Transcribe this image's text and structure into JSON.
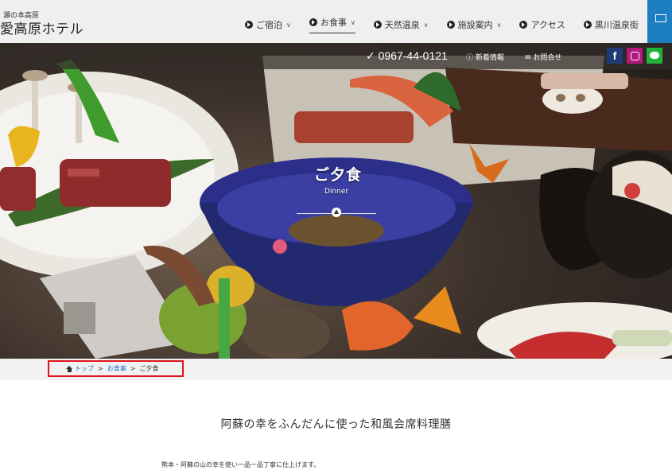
{
  "header": {
    "logo_small": "瀬の本高原",
    "logo_main": "愛高原ホテル",
    "nav": [
      {
        "label": "ご宿泊",
        "dropdown": true,
        "active": false
      },
      {
        "label": "お食事",
        "dropdown": true,
        "active": true
      },
      {
        "label": "天然温泉",
        "dropdown": true,
        "active": false
      },
      {
        "label": "施設案内",
        "dropdown": true,
        "active": false
      },
      {
        "label": "アクセス",
        "dropdown": false,
        "active": false
      },
      {
        "label": "黒川温泉街",
        "dropdown": false,
        "active": false
      }
    ],
    "accent_color": "#1d7fc1"
  },
  "contact": {
    "phone": "0967-44-0121",
    "news_label": "新着情報",
    "inquiry_label": "お問合せ",
    "facebook_glyph": "f",
    "social_icons": [
      "facebook-icon",
      "instagram-icon",
      "line-icon"
    ]
  },
  "hero": {
    "title": "ご夕食",
    "subtitle": "Dinner"
  },
  "breadcrumb": {
    "items": [
      "トップ",
      "お食事",
      "ご夕食"
    ],
    "separator": ">",
    "highlight_color": "#e0151b"
  },
  "main": {
    "heading": "阿蘇の幸をふんだんに使った和風会席料理膳",
    "intro": "熊本・阿蘇の山の幸を使い一品一品丁寧に仕上げます。"
  }
}
